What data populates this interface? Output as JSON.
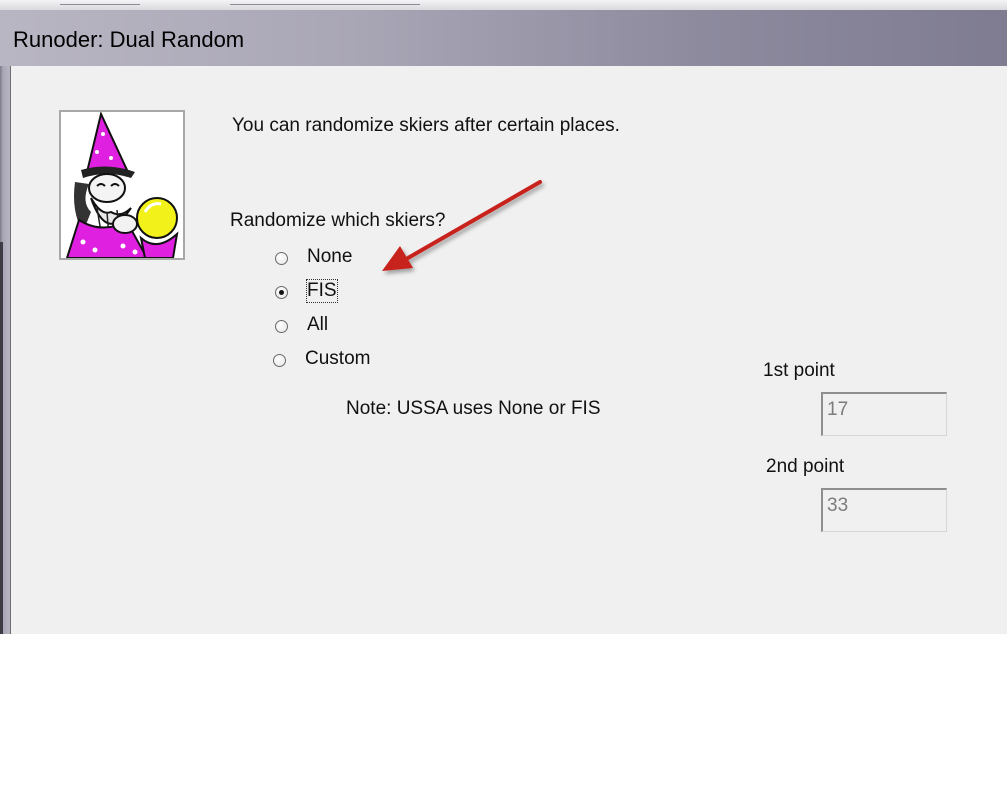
{
  "window": {
    "title": "Runoder: Dual Random"
  },
  "intro_text": "You can randomize skiers after certain places.",
  "question": "Randomize which skiers?",
  "randomize_options": [
    {
      "label": "None",
      "selected": false
    },
    {
      "label": "FIS",
      "selected": true
    },
    {
      "label": "All",
      "selected": false
    },
    {
      "label": "Custom",
      "selected": false
    }
  ],
  "note": "Note: USSA uses None or FIS",
  "first_point": {
    "label": "1st point",
    "value": "17"
  },
  "second_point": {
    "label": "2nd point",
    "value": "33"
  },
  "colors": {
    "annotation_arrow": "#c8201e",
    "wizard_robe": "#e020e0",
    "crystal_ball": "#f2f21a"
  }
}
